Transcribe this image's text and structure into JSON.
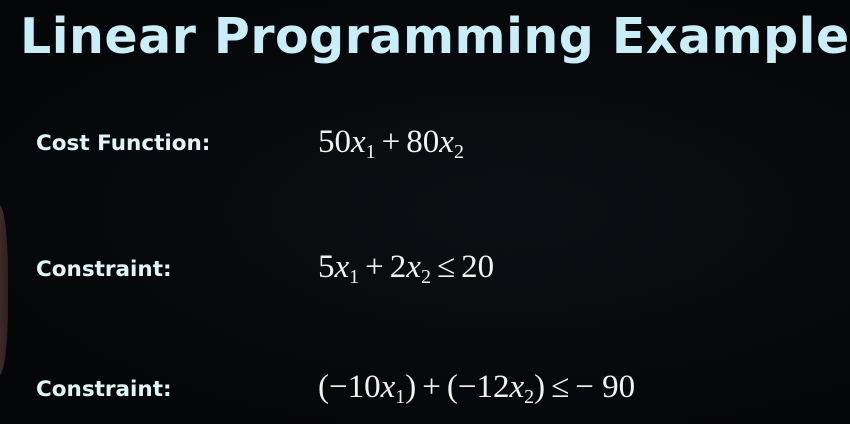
{
  "title": "Linear Programming Example",
  "rows": [
    {
      "label": "Cost Function:",
      "tokens": [
        {
          "t": "50"
        },
        {
          "t": "x",
          "i": true
        },
        {
          "t": "1",
          "sub": true
        },
        {
          "t": "+",
          "op": true
        },
        {
          "t": "80"
        },
        {
          "t": "x",
          "i": true
        },
        {
          "t": "2",
          "sub": true
        }
      ]
    },
    {
      "label": "Constraint:",
      "tokens": [
        {
          "t": "5"
        },
        {
          "t": "x",
          "i": true
        },
        {
          "t": "1",
          "sub": true
        },
        {
          "t": "+",
          "op": true
        },
        {
          "t": "2"
        },
        {
          "t": "x",
          "i": true
        },
        {
          "t": "2",
          "sub": true
        },
        {
          "t": "≤",
          "op": true
        },
        {
          "t": "20"
        }
      ]
    },
    {
      "label": "Constraint:",
      "tokens": [
        {
          "t": "(−10"
        },
        {
          "t": "x",
          "i": true
        },
        {
          "t": "1",
          "sub": true
        },
        {
          "t": ")"
        },
        {
          "t": "+",
          "op": true
        },
        {
          "t": "(−12"
        },
        {
          "t": "x",
          "i": true
        },
        {
          "t": "2",
          "sub": true
        },
        {
          "t": ")"
        },
        {
          "t": "≤",
          "op": true
        },
        {
          "t": "− 90"
        }
      ]
    }
  ],
  "colors": {
    "background": "#07080b",
    "title": "#c9eef7",
    "label": "#dff5f7",
    "equation": "#f2f2ee"
  }
}
